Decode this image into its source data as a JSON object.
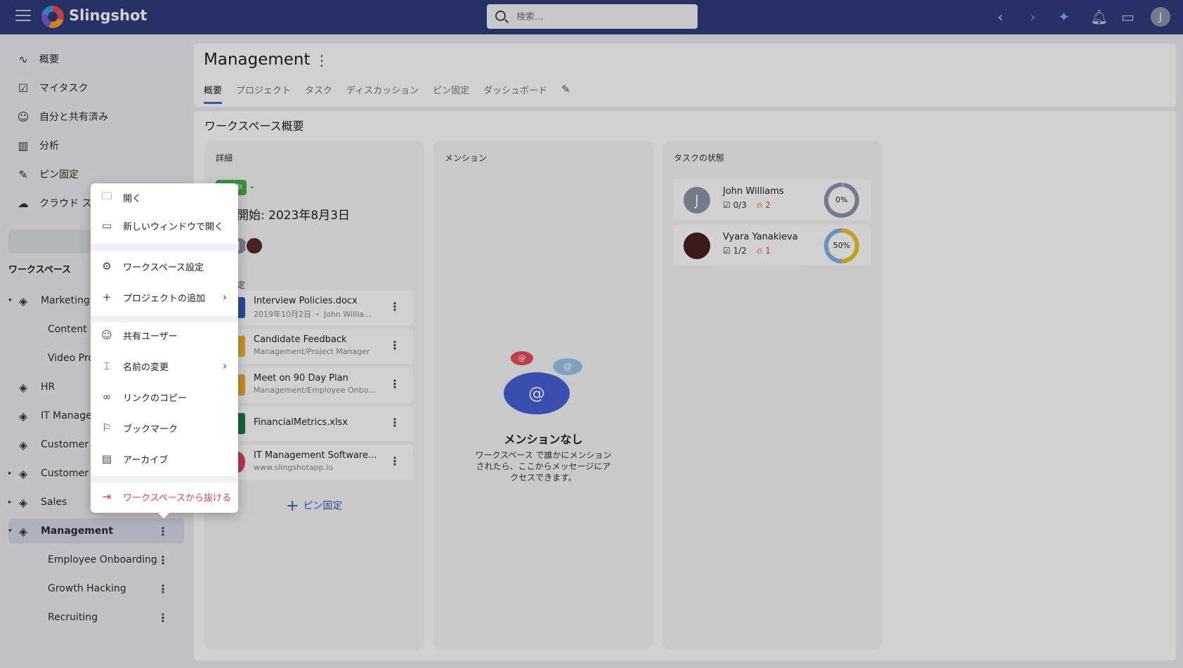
{
  "app": {
    "name": "Slingshot"
  },
  "search": {
    "placeholder": "検索..."
  },
  "user": {
    "initial": "J"
  },
  "sidebar": {
    "nav": [
      {
        "label": "概要",
        "icon": "activity-icon"
      },
      {
        "label": "マイタスク",
        "icon": "clipboard-check-icon"
      },
      {
        "label": "自分と共有済み",
        "icon": "user-check-icon"
      },
      {
        "label": "分析",
        "icon": "bar-chart-icon"
      },
      {
        "label": "ピン固定",
        "icon": "pin-icon"
      },
      {
        "label": "クラウド ストレ",
        "icon": "cloud-icon"
      }
    ],
    "workspaces_heading": "ワークスペース",
    "workspaces": [
      {
        "label": "Marketing"
      },
      {
        "label": "Content C"
      },
      {
        "label": "Video Pro"
      },
      {
        "label": "HR"
      },
      {
        "label": "IT Managem"
      },
      {
        "label": "Customer S"
      },
      {
        "label": "Customer In"
      },
      {
        "label": "Sales"
      },
      {
        "label": "Management"
      },
      {
        "label": "Employee Onboarding"
      },
      {
        "label": "Growth Hacking"
      },
      {
        "label": "Recruiting"
      }
    ]
  },
  "header": {
    "title": "Management",
    "tabs": [
      "概要",
      "プロジェクト",
      "タスク",
      "ディスカッション",
      "ピン固定",
      "ダッシュボード"
    ]
  },
  "overview": {
    "section_title": "ワークスペース概要",
    "details": {
      "title": "詳細",
      "status": "中",
      "start_date": "開始: 2023年8月3日",
      "pinned_label": "定",
      "files": [
        {
          "name": "Interview Policies.docx",
          "sub": "2019年10月2日 ・ John Willia..."
        },
        {
          "name": "Candidate Feedback",
          "sub": "Management/Project Manager"
        },
        {
          "name": "Meet on 90 Day Plan",
          "sub": "Management/Employee Onbo..."
        },
        {
          "name": "FinancialMetrics.xlsx",
          "sub": ""
        },
        {
          "name": "IT Management Software...",
          "sub": "www.slingshotapp.io"
        }
      ],
      "add_pin": "ピン固定"
    },
    "mentions": {
      "title": "メンション",
      "empty_title": "メンションなし",
      "empty_text": "ワークスペース で誰かにメンションされたら、ここからメッセージにアクセスできます。"
    },
    "task_status": {
      "title": "タスクの状態",
      "people": [
        {
          "name": "John Williams",
          "initial": "J",
          "tasks": "0/3",
          "hot": "2",
          "percent": "0%",
          "progress": 0
        },
        {
          "name": "Vyara Yanakieva",
          "initial": "",
          "tasks": "1/2",
          "hot": "1",
          "percent": "50%",
          "progress": 50
        }
      ]
    }
  },
  "context_menu": {
    "items": [
      {
        "label": "開く",
        "icon": "folder-open-icon"
      },
      {
        "label": "新しいウィンドウで開く",
        "icon": "new-window-icon"
      },
      {
        "label": "ワークスペース設定",
        "icon": "gear-icon"
      },
      {
        "label": "プロジェクトの追加",
        "icon": "plus-icon"
      },
      {
        "label": "共有ユーザー",
        "icon": "user-plus-icon"
      },
      {
        "label": "名前の変更",
        "icon": "rename-icon"
      },
      {
        "label": "リンクのコピー",
        "icon": "link-icon"
      },
      {
        "label": "ブックマーク",
        "icon": "bookmark-icon"
      },
      {
        "label": "アーカイブ",
        "icon": "archive-icon"
      },
      {
        "label": "ワークスペースから抜ける",
        "icon": "exit-icon"
      }
    ]
  },
  "colors": {
    "topbar": "#2f3d7c",
    "accent": "#4d63c7",
    "danger": "#e0454f",
    "status_green": "#46b34a"
  }
}
